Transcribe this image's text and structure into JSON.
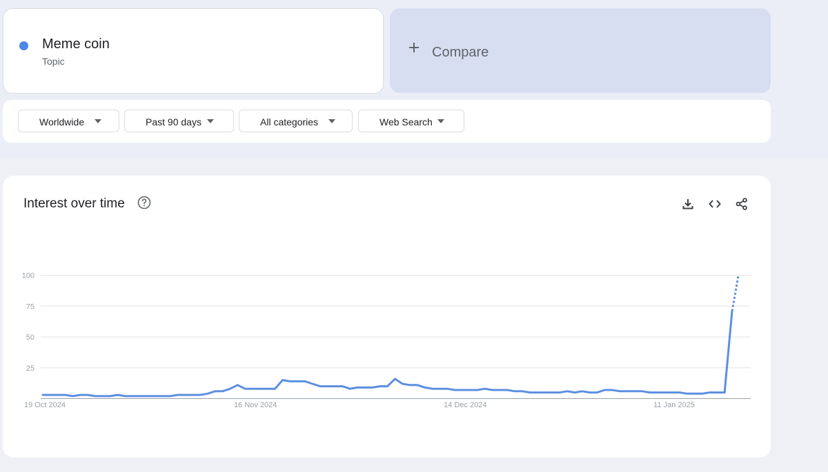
{
  "term": {
    "name": "Meme coin",
    "type": "Topic",
    "color": "#4c86e8"
  },
  "compare": {
    "label": "Compare"
  },
  "filters": [
    {
      "label": "Worldwide"
    },
    {
      "label": "Past 90 days"
    },
    {
      "label": "All categories"
    },
    {
      "label": "Web Search"
    }
  ],
  "panel": {
    "title": "Interest over time",
    "icons": [
      "help-circle-icon",
      "download-icon",
      "embed-code-icon",
      "share-icon"
    ]
  },
  "chart_data": {
    "type": "line",
    "title": "Interest over time",
    "xlabel": "",
    "ylabel": "",
    "ylim": [
      0,
      100
    ],
    "yticks": [
      25,
      50,
      75,
      100
    ],
    "xtick_labels": [
      "19 Oct 2024",
      "16 Nov 2024",
      "14 Dec 2024",
      "11 Jan 2025"
    ],
    "grid": true,
    "x_start": "2024-10-19",
    "x_end": "2025-01-17",
    "series": [
      {
        "color": "#5b8fe0",
        "values": [
          3,
          3,
          3,
          3,
          2,
          3,
          3,
          2,
          2,
          2,
          3,
          2,
          2,
          2,
          2,
          2,
          2,
          2,
          3,
          3,
          3,
          3,
          4,
          6,
          6,
          8,
          11,
          8,
          8,
          8,
          8,
          8,
          15,
          14,
          14,
          14,
          12,
          10,
          10,
          10,
          10,
          8,
          9,
          9,
          9,
          10,
          10,
          16,
          12,
          11,
          11,
          9,
          8,
          8,
          8,
          7,
          7,
          7,
          7,
          8,
          7,
          7,
          7,
          6,
          6,
          5,
          5,
          5,
          5,
          5,
          6,
          5,
          6,
          5,
          5,
          7,
          7,
          6,
          6,
          6,
          6,
          5,
          5,
          5,
          5,
          5,
          4,
          4,
          4,
          5,
          5,
          5,
          71
        ],
        "partial_last": 100
      }
    ]
  }
}
